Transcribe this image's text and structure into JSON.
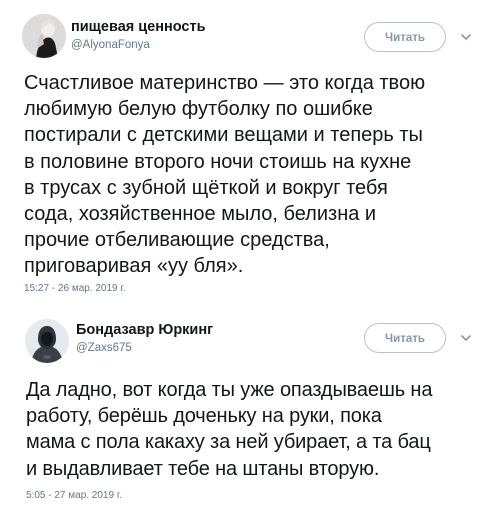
{
  "tweets": [
    {
      "display_name": "пищевая ценность",
      "handle": "@AlyonaFonya",
      "follow_label": "Читать",
      "text": "Счастливое материнство — это когда твою\nлюбимую белую футболку по ошибке\nпостирали с детскими вещами и теперь ты\nв половине второго ночи стоишь на кухне\nв трусах с зубной щёткой и вокруг тебя\nсода, хозяйственное мыло, белизна и\nпрочие отбеливающие средства,\nприговаривая «уу бля».",
      "timestamp": "15:27 - 26 мар. 2019 г.",
      "avatar_icon": "user-avatar-photo",
      "menu_icon": "chevron-down-icon"
    },
    {
      "display_name": "Бондазавр Юркинг",
      "handle": "@Zaxs675",
      "follow_label": "Читать",
      "text": "Да ладно, вот когда ты уже опаздываешь на\nработу, берёшь доченьку на руки, пока\nмама с пола какаху за ней убирает, а та бац\nи выдавливает тебе на штаны вторую.",
      "timestamp": "5:05 - 27 мар. 2019 г.",
      "avatar_icon": "user-avatar-photo",
      "menu_icon": "chevron-down-icon"
    }
  ]
}
